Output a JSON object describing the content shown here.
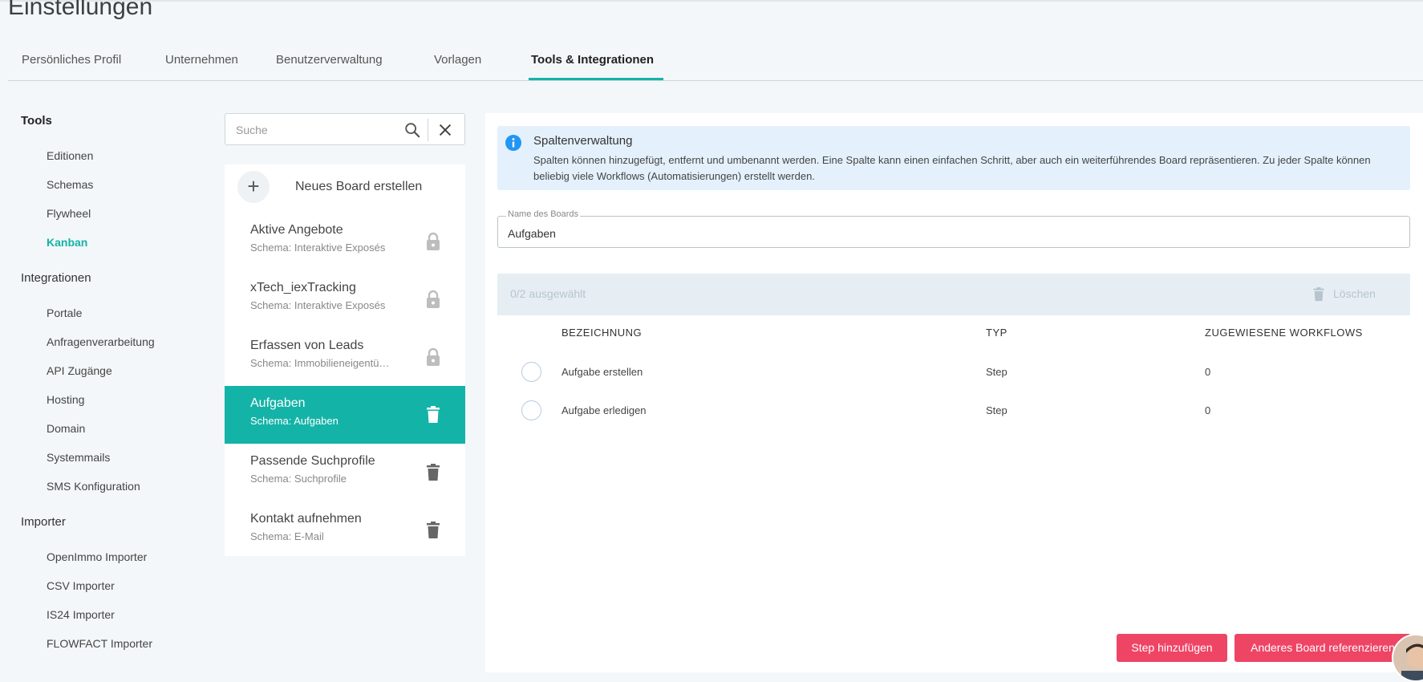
{
  "page": {
    "title": "Einstellungen"
  },
  "tabs": [
    {
      "label": "Persönliches Profil"
    },
    {
      "label": "Unternehmen"
    },
    {
      "label": "Benutzerverwaltung"
    },
    {
      "label": "Vorlagen"
    },
    {
      "label": "Tools & Integrationen",
      "active": true
    }
  ],
  "sidebar": {
    "tools": {
      "title": "Tools",
      "items": [
        {
          "label": "Editionen"
        },
        {
          "label": "Schemas"
        },
        {
          "label": "Flywheel"
        },
        {
          "label": "Kanban",
          "active": true
        }
      ]
    },
    "integrationen": {
      "title": "Integrationen",
      "items": [
        {
          "label": "Portale"
        },
        {
          "label": "Anfragenverarbeitung"
        },
        {
          "label": "API Zugänge"
        },
        {
          "label": "Hosting"
        },
        {
          "label": "Domain"
        },
        {
          "label": "Systemmails"
        },
        {
          "label": "SMS Konfiguration"
        }
      ]
    },
    "importer": {
      "title": "Importer",
      "items": [
        {
          "label": "OpenImmo Importer"
        },
        {
          "label": "CSV Importer"
        },
        {
          "label": "IS24 Importer"
        },
        {
          "label": "FLOWFACT Importer"
        }
      ]
    }
  },
  "search": {
    "placeholder": "Suche",
    "icon": "search-icon",
    "clear_icon": "close-icon"
  },
  "boards": {
    "new_label": "Neues Board erstellen",
    "items": [
      {
        "name": "Aktive Angebote",
        "schema": "Schema: Interaktive Exposés",
        "icon": "lock-icon"
      },
      {
        "name": "xTech_iexTracking",
        "schema": "Schema: Interaktive Exposés",
        "icon": "lock-icon"
      },
      {
        "name": "Erfassen von Leads",
        "schema": "Schema: Immobilieneigentümer",
        "icon": "lock-icon"
      },
      {
        "name": "Aufgaben",
        "schema": "Schema: Aufgaben",
        "icon": "trash-icon",
        "active": true
      },
      {
        "name": "Passende Suchprofile",
        "schema": "Schema: Suchprofile",
        "icon": "trash-icon"
      },
      {
        "name": "Kontakt aufnehmen",
        "schema": "Schema: E-Mail",
        "icon": "trash-icon"
      }
    ]
  },
  "info": {
    "title": "Spaltenverwaltung",
    "text": "Spalten können hinzugefügt, entfernt und umbenannt werden. Eine Spalte kann einen einfachen Schritt, aber auch ein weiterführendes Board repräsentieren. Zu jeder Spalte können beliebig viele Workflows (Automatisierungen) erstellt werden.",
    "icon": "info-icon"
  },
  "board_name": {
    "label": "Name des Boards",
    "value": "Aufgaben"
  },
  "selection": {
    "count": "0/2 ausgewählt",
    "delete_label": "Löschen"
  },
  "table": {
    "headers": {
      "name": "BEZEICHNUNG",
      "type": "TYP",
      "workflows": "ZUGEWIESENE WORKFLOWS"
    },
    "rows": [
      {
        "name": "Aufgabe erstellen",
        "type": "Step",
        "workflows": "0"
      },
      {
        "name": "Aufgabe erledigen",
        "type": "Step",
        "workflows": "0"
      }
    ]
  },
  "actions": {
    "add_step": "Step hinzufügen",
    "reference_board": "Anderes Board referenzieren"
  },
  "colors": {
    "accent": "#14b3a7",
    "danger": "#ef4565",
    "info_bg": "#e4f1fd",
    "info_icon": "#2196f3"
  }
}
